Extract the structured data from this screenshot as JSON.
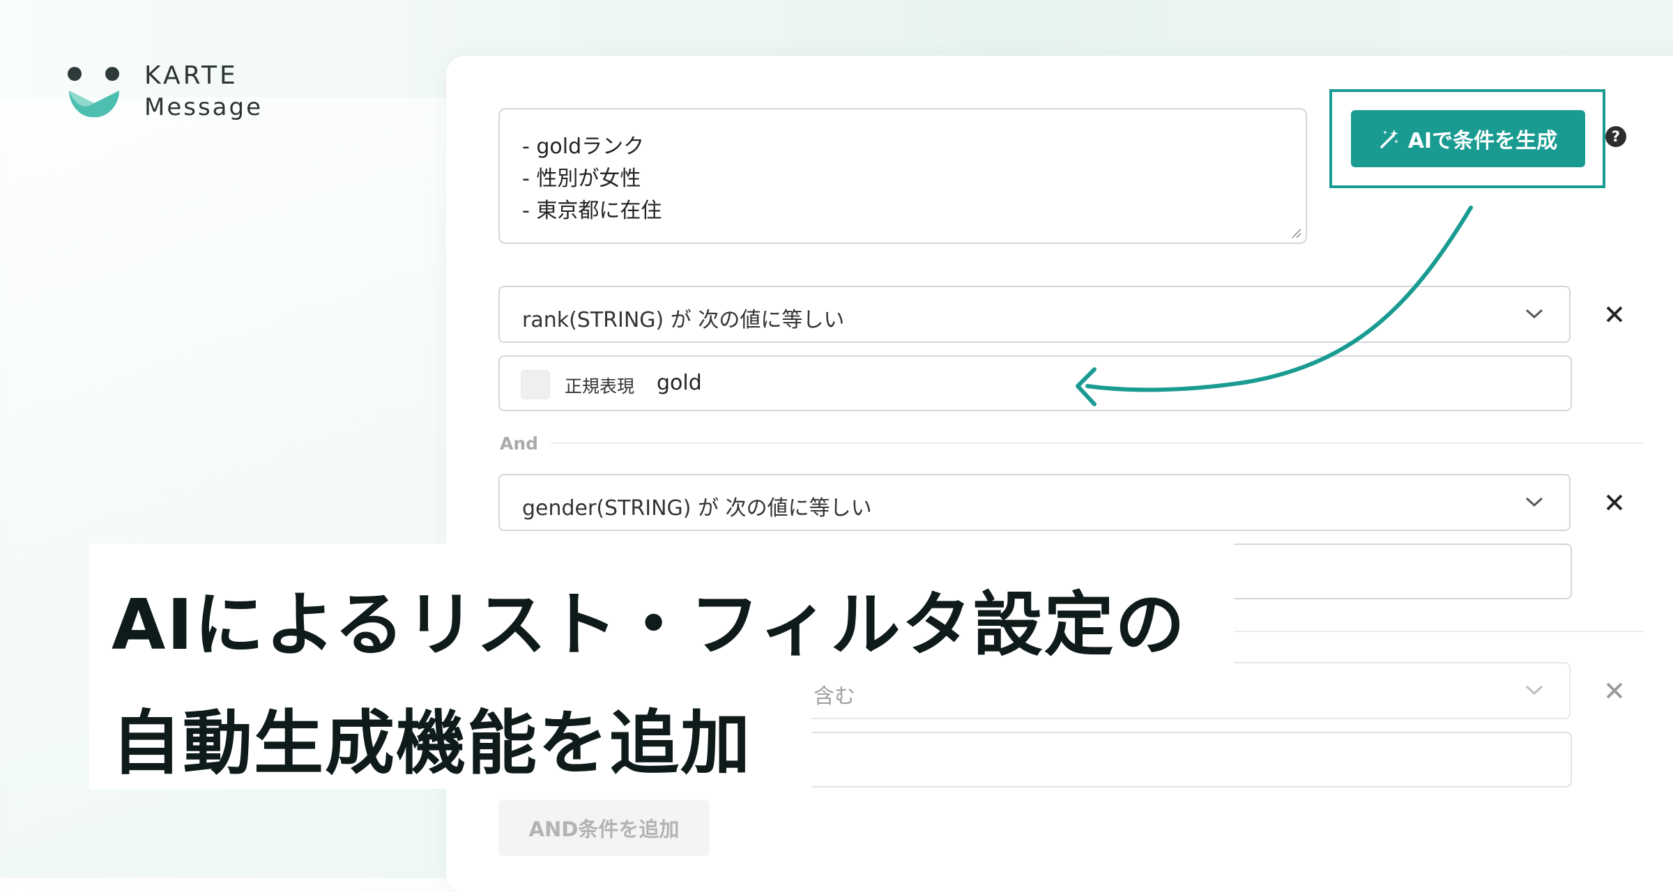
{
  "brand": {
    "line1": "KARTE",
    "line2": "Message"
  },
  "prompt": {
    "lines": [
      "- goldランク",
      "- 性別が女性",
      "- 東京都に在住"
    ]
  },
  "ai_button": {
    "label": "AIで条件を生成",
    "icon": "magic-wand-icon"
  },
  "help_icon": {
    "text": "?"
  },
  "conditions": [
    {
      "select_text": "rank(STRING) が 次の値に等しい",
      "regex_label": "正規表現",
      "value": "gold"
    },
    {
      "select_text": "gender(STRING) が 次の値に等しい",
      "value": ""
    },
    {
      "select_text": "含む",
      "value": ""
    }
  ],
  "and_label": "And",
  "add_and_button": "AND条件を追加",
  "headline": {
    "line1": "AIによるリスト・フィルタ設定の",
    "line2": "自動生成機能を追加"
  },
  "colors": {
    "accent": "#1a9b92",
    "text": "#0f1a1a",
    "border": "#d3d6d7"
  }
}
